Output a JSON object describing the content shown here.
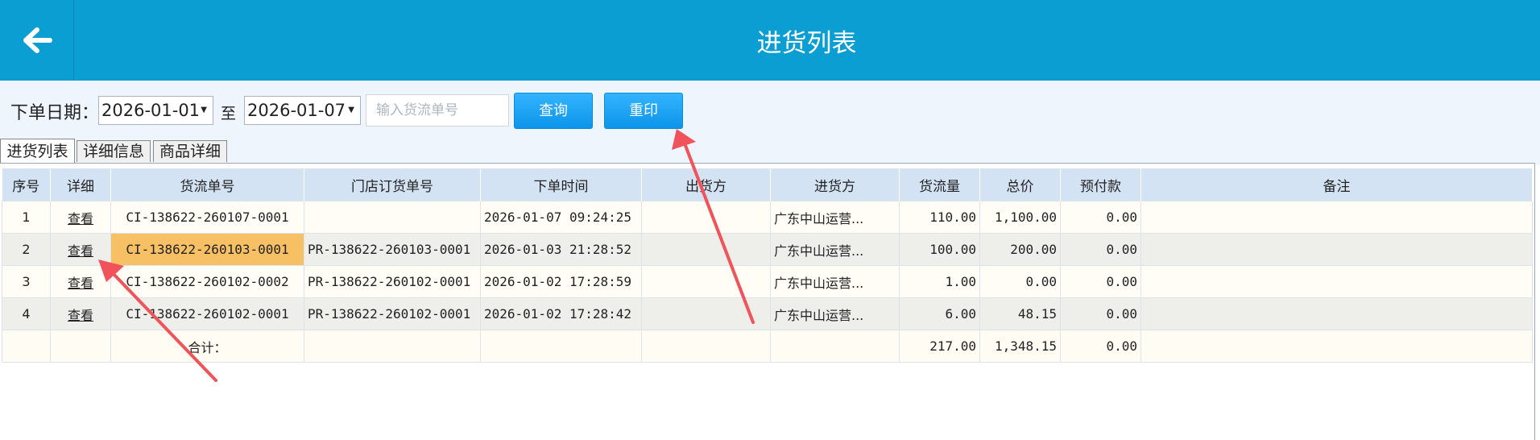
{
  "header": {
    "title": "进货列表",
    "back_icon": "arrow-left-icon"
  },
  "toolbar": {
    "date_label": "下单日期：",
    "date_from": "2026-01-01",
    "to_label": "至",
    "date_to": "2026-01-07",
    "order_placeholder": "输入货流单号",
    "order_value": "",
    "query_label": "查询",
    "reprint_label": "重印"
  },
  "tabs": [
    {
      "label": "进货列表",
      "active": true
    },
    {
      "label": "详细信息",
      "active": false
    },
    {
      "label": "商品详细",
      "active": false
    }
  ],
  "table": {
    "columns": [
      "序号",
      "详细",
      "货流单号",
      "门店订货单号",
      "下单时间",
      "出货方",
      "进货方",
      "货流量",
      "总价",
      "预付款",
      "备注"
    ],
    "rows": [
      {
        "no": "1",
        "detail": "查看",
        "flow_no": "CI-138622-260107-0001",
        "store_order_no": "",
        "order_time": "2026-01-07 09:24:25",
        "shipper": "",
        "receiver": "广东中山运营...",
        "qty": "110.00",
        "total": "1,100.00",
        "prepay": "0.00",
        "remark": ""
      },
      {
        "no": "2",
        "detail": "查看",
        "flow_no": "CI-138622-260103-0001",
        "store_order_no": "PR-138622-260103-0001",
        "order_time": "2026-01-03 21:28:52",
        "shipper": "",
        "receiver": "广东中山运营...",
        "qty": "100.00",
        "total": "200.00",
        "prepay": "0.00",
        "remark": ""
      },
      {
        "no": "3",
        "detail": "查看",
        "flow_no": "CI-138622-260102-0002",
        "store_order_no": "PR-138622-260102-0001",
        "order_time": "2026-01-02 17:28:59",
        "shipper": "",
        "receiver": "广东中山运营...",
        "qty": "1.00",
        "total": "0.00",
        "prepay": "0.00",
        "remark": ""
      },
      {
        "no": "4",
        "detail": "查看",
        "flow_no": "CI-138622-260102-0001",
        "store_order_no": "PR-138622-260102-0001",
        "order_time": "2026-01-02 17:28:42",
        "shipper": "",
        "receiver": "广东中山运营...",
        "qty": "6.00",
        "total": "48.15",
        "prepay": "0.00",
        "remark": ""
      }
    ],
    "summary": {
      "label": "合计：",
      "qty": "217.00",
      "total": "1,348.15",
      "prepay": "0.00"
    }
  },
  "colors": {
    "header_bg": "#0a9ed2",
    "toolbar_bg": "#eef5fd",
    "button_bg": "#1ea4f5",
    "table_header_bg": "#d4e3f4",
    "selected_cell": "#f8c064",
    "annotation_arrow": "#f0535a"
  }
}
